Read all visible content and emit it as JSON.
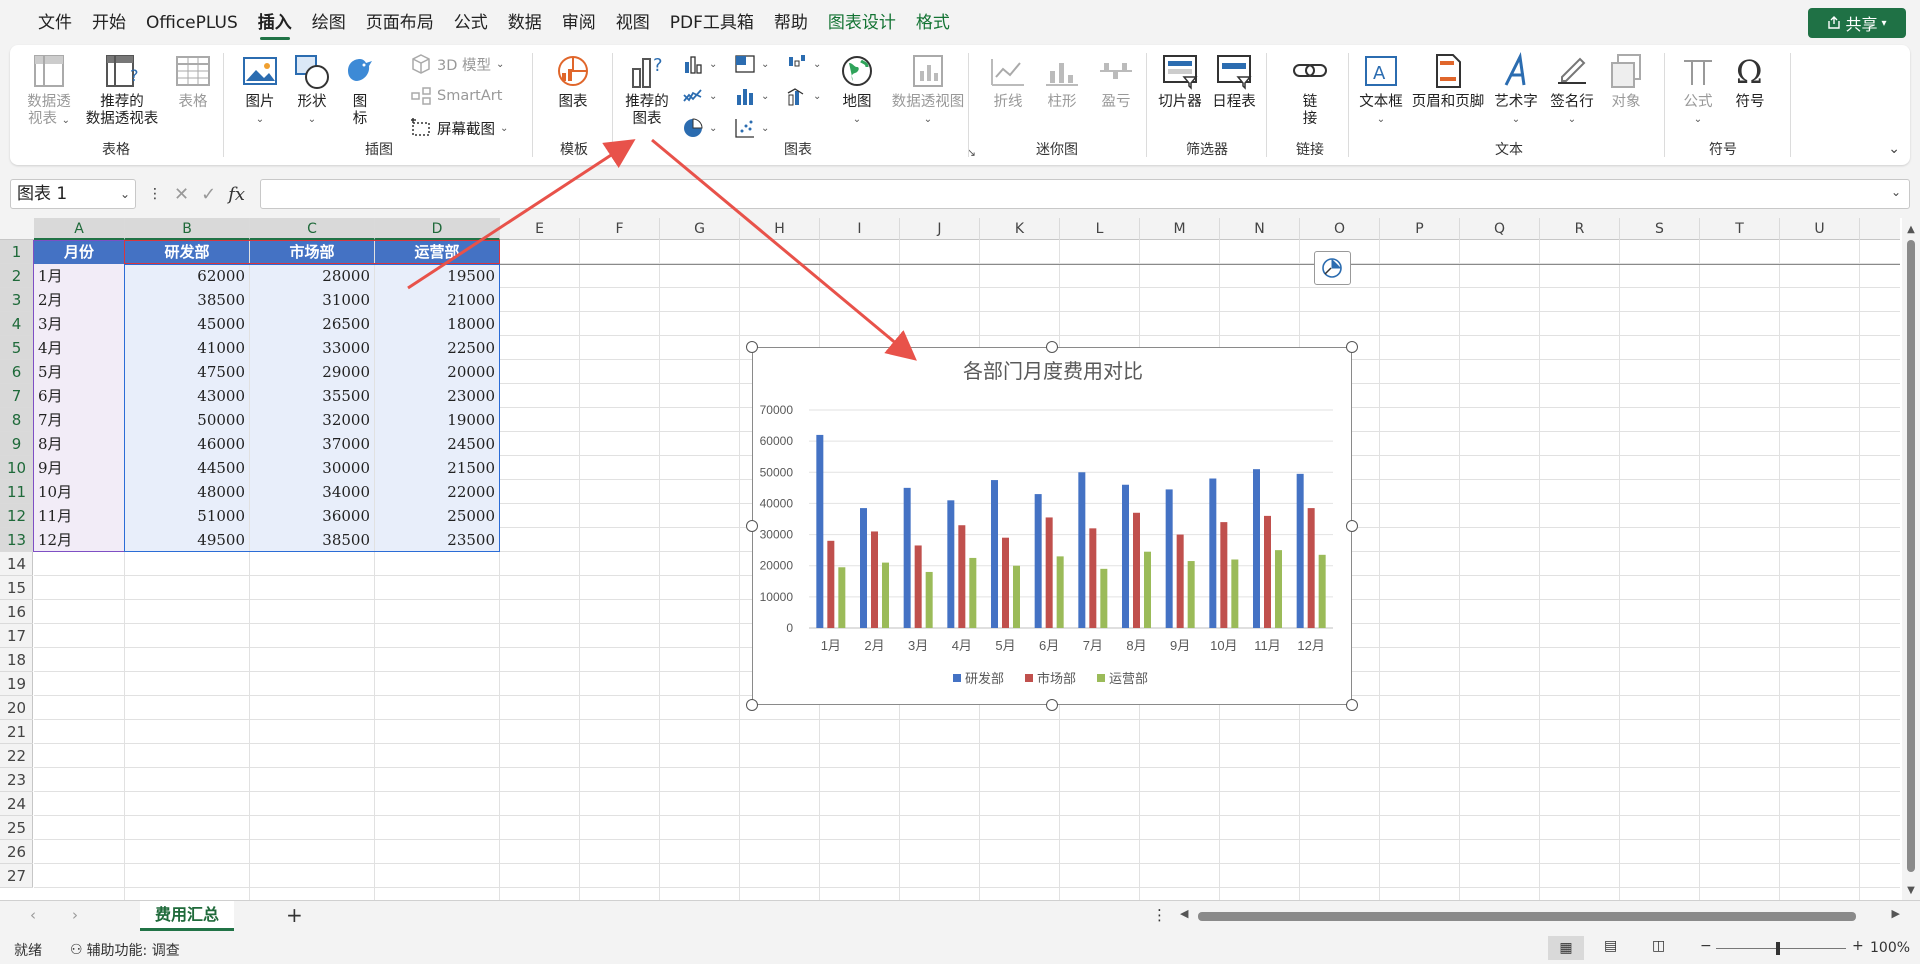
{
  "menu": {
    "items": [
      "文件",
      "开始",
      "OfficePLUS",
      "插入",
      "绘图",
      "页面布局",
      "公式",
      "数据",
      "审阅",
      "视图",
      "PDF工具箱",
      "帮助"
    ],
    "context_tabs": [
      "图表设计",
      "格式"
    ],
    "active": "插入",
    "share_label": "共享"
  },
  "ribbon": {
    "groups": {
      "tables": {
        "label": "表格",
        "pivot_line1": "数据透",
        "pivot_line2": "视表",
        "rec_pivot_line1": "推荐的",
        "rec_pivot_line2": "数据透视表",
        "table": "表格"
      },
      "illustrations": {
        "label": "插图",
        "picture": "图片",
        "shapes": "形状",
        "icons_line1": "图",
        "icons_line2": "标",
        "model3d": "3D 模型",
        "smartart": "SmartArt",
        "screenshot": "屏幕截图"
      },
      "templates": {
        "label": "模板",
        "chart": "图表"
      },
      "charts": {
        "label": "图表",
        "rec_line1": "推荐的",
        "rec_line2": "图表",
        "map": "地图",
        "pivotchart": "数据透视图"
      },
      "sparklines": {
        "label": "迷你图",
        "line": "折线",
        "column": "柱形",
        "winloss": "盈亏"
      },
      "filters": {
        "label": "筛选器",
        "slicer": "切片器",
        "timeline": "日程表"
      },
      "links": {
        "label": "链接",
        "link_line1": "链",
        "link_line2": "接"
      },
      "text": {
        "label": "文本",
        "textbox": "文本框",
        "headerfooter": "页眉和页脚",
        "wordart": "艺术字",
        "signature": "签名行",
        "object": "对象"
      },
      "symbols": {
        "label": "符号",
        "equation": "公式",
        "symbol": "符号"
      }
    }
  },
  "formula_bar": {
    "name_box": "图表 1",
    "fx": "fx",
    "value": ""
  },
  "columns": [
    "A",
    "B",
    "C",
    "D",
    "E",
    "F",
    "G",
    "H",
    "I",
    "J",
    "K",
    "L",
    "M",
    "N",
    "O",
    "P",
    "Q",
    "R",
    "S",
    "T",
    "U"
  ],
  "rows": [
    "1",
    "2",
    "3",
    "4",
    "5",
    "6",
    "7",
    "8",
    "9",
    "10",
    "11",
    "12",
    "13",
    "14",
    "15",
    "16",
    "17",
    "18",
    "19",
    "20",
    "21",
    "22",
    "23",
    "24",
    "25",
    "26",
    "27"
  ],
  "table": {
    "headers": [
      "月份",
      "研发部",
      "市场部",
      "运营部"
    ],
    "rows": [
      [
        "1月",
        "62000",
        "28000",
        "19500"
      ],
      [
        "2月",
        "38500",
        "31000",
        "21000"
      ],
      [
        "3月",
        "45000",
        "26500",
        "18000"
      ],
      [
        "4月",
        "41000",
        "33000",
        "22500"
      ],
      [
        "5月",
        "47500",
        "29000",
        "20000"
      ],
      [
        "6月",
        "43000",
        "35500",
        "23000"
      ],
      [
        "7月",
        "50000",
        "32000",
        "19000"
      ],
      [
        "8月",
        "46000",
        "37000",
        "24500"
      ],
      [
        "9月",
        "44500",
        "30000",
        "21500"
      ],
      [
        "10月",
        "48000",
        "34000",
        "22000"
      ],
      [
        "11月",
        "51000",
        "36000",
        "25000"
      ],
      [
        "12月",
        "49500",
        "38500",
        "23500"
      ]
    ]
  },
  "chart_data": {
    "type": "bar",
    "title": "各部门月度费用对比",
    "categories": [
      "1月",
      "2月",
      "3月",
      "4月",
      "5月",
      "6月",
      "7月",
      "8月",
      "9月",
      "10月",
      "11月",
      "12月"
    ],
    "series": [
      {
        "name": "研发部",
        "color": "#4472c4",
        "values": [
          62000,
          38500,
          45000,
          41000,
          47500,
          43000,
          50000,
          46000,
          44500,
          48000,
          51000,
          49500
        ]
      },
      {
        "name": "市场部",
        "color": "#c0504d",
        "values": [
          28000,
          31000,
          26500,
          33000,
          29000,
          35500,
          32000,
          37000,
          30000,
          34000,
          36000,
          38500
        ]
      },
      {
        "name": "运营部",
        "color": "#9bbb59",
        "values": [
          19500,
          21000,
          18000,
          22500,
          20000,
          23000,
          19000,
          24500,
          21500,
          22000,
          25000,
          23500
        ]
      }
    ],
    "ylim": [
      0,
      70000
    ],
    "yticks": [
      "70000",
      "60000",
      "50000",
      "40000",
      "30000",
      "20000",
      "10000",
      "0"
    ],
    "grid": true,
    "legend": "bottom"
  },
  "sheet_tabs": {
    "tabs": [
      "费用汇总"
    ],
    "active": "费用汇总",
    "add": "+"
  },
  "status": {
    "ready": "就绪",
    "accessibility": "辅助功能: 调查",
    "zoom": "100%",
    "minus": "−",
    "plus": "+"
  }
}
